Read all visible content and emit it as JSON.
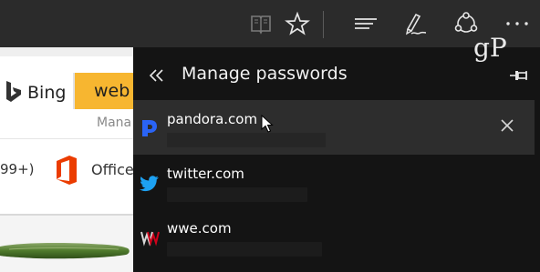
{
  "toolbar": {
    "icons": [
      "reading-view-icon",
      "favorite-star-icon",
      "hub-icon",
      "web-note-icon",
      "share-icon",
      "more-icon"
    ]
  },
  "watermark": {
    "text": "gP"
  },
  "background_page": {
    "bing_label": "Bing",
    "web_tab_label": "web",
    "partial_text": "Mana",
    "count_label": "99+)",
    "office_label": "Office"
  },
  "panel": {
    "title": "Manage passwords",
    "entries": [
      {
        "site": "pandora.com",
        "logo": "pandora-logo-icon",
        "logo_color": "#2a64f6",
        "selected": true
      },
      {
        "site": "twitter.com",
        "logo": "twitter-logo-icon",
        "logo_color": "#1da1f2",
        "selected": false
      },
      {
        "site": "wwe.com",
        "logo": "wwe-logo-icon",
        "logo_color": "#d0021b",
        "selected": false
      }
    ]
  },
  "colors": {
    "panel_bg": "#141414",
    "row_selected_bg": "#2d2d2d",
    "toolbar_bg": "#2b2b2b",
    "web_tab_bg": "#f7b630",
    "office_red": "#eb3c00"
  }
}
